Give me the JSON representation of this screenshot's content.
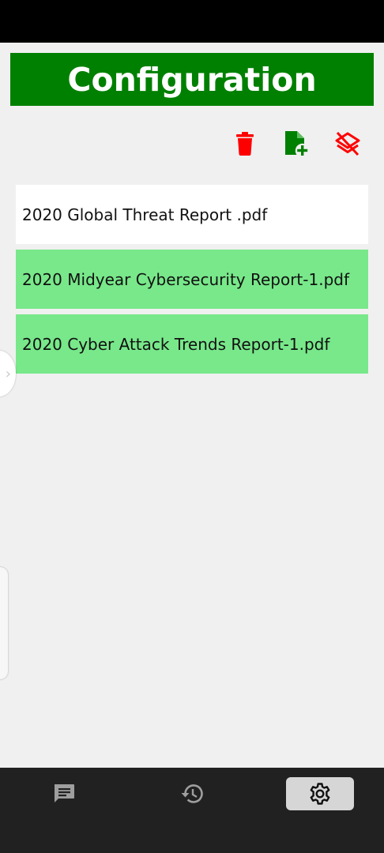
{
  "header": {
    "title": "Configuration"
  },
  "toolbar": {
    "delete_icon": "trash-icon",
    "add_file_icon": "file-plus-icon",
    "clear_layers_icon": "layers-off-icon",
    "colors": {
      "delete": "#ff0000",
      "add": "#008000",
      "clear": "#ff0000"
    }
  },
  "files": [
    {
      "name": "2020 Global Threat Report .pdf",
      "selected": false
    },
    {
      "name": "2020 Midyear Cybersecurity Report-1.pdf",
      "selected": true
    },
    {
      "name": "2020 Cyber Attack Trends Report-1.pdf",
      "selected": true
    }
  ],
  "bottom_nav": {
    "items": [
      {
        "icon": "chat-icon",
        "active": false
      },
      {
        "icon": "history-icon",
        "active": false
      },
      {
        "icon": "settings-gear-icon",
        "active": true
      }
    ]
  },
  "colors": {
    "header_bg": "#008000",
    "selected_row": "#78e88a",
    "nav_bg": "#212121"
  }
}
